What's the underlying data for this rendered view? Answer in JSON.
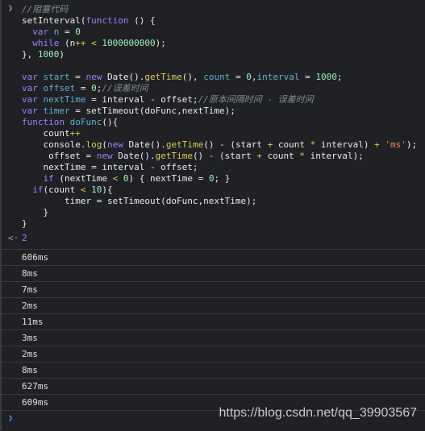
{
  "input": {
    "prompt_icon": "chevron-right-icon",
    "lines": [
      [
        [
          "cm",
          "//阻塞代码"
        ]
      ],
      [
        [
          "pl",
          "setInterval("
        ],
        [
          "kw",
          "function"
        ],
        [
          "pl",
          " () {"
        ]
      ],
      [
        [
          "pl",
          "  "
        ],
        [
          "kw",
          "var"
        ],
        [
          "var",
          " n"
        ],
        [
          "pl",
          " = "
        ],
        [
          "num",
          "0"
        ]
      ],
      [
        [
          "pl",
          "  "
        ],
        [
          "kw",
          "while"
        ],
        [
          "pl",
          " (n"
        ],
        [
          "op",
          "++"
        ],
        [
          "pl",
          " "
        ],
        [
          "op",
          "<"
        ],
        [
          "pl",
          " "
        ],
        [
          "num",
          "1000000000"
        ],
        [
          "pl",
          ");"
        ]
      ],
      [
        [
          "pl",
          "}, "
        ],
        [
          "num",
          "1000"
        ],
        [
          "pl",
          ")"
        ]
      ],
      [
        [
          "pl",
          ""
        ]
      ],
      [
        [
          "kw",
          "var"
        ],
        [
          "var",
          " start"
        ],
        [
          "pl",
          " = "
        ],
        [
          "kw",
          "new"
        ],
        [
          "pl",
          " Date()."
        ],
        [
          "fn",
          "getTime"
        ],
        [
          "pl",
          "(), "
        ],
        [
          "var",
          "count"
        ],
        [
          "pl",
          " = "
        ],
        [
          "num",
          "0"
        ],
        [
          "pl",
          ","
        ],
        [
          "var",
          "interval"
        ],
        [
          "pl",
          " = "
        ],
        [
          "num",
          "1000"
        ],
        [
          "pl",
          ";"
        ]
      ],
      [
        [
          "kw",
          "var"
        ],
        [
          "var",
          " offset"
        ],
        [
          "pl",
          " = "
        ],
        [
          "num",
          "0"
        ],
        [
          "pl",
          ";"
        ],
        [
          "cm",
          "//误差时间"
        ]
      ],
      [
        [
          "kw",
          "var"
        ],
        [
          "var",
          " nextTime"
        ],
        [
          "pl",
          " = interval - offset;"
        ],
        [
          "cm",
          "//原本间隔时间 - 误差时间"
        ]
      ],
      [
        [
          "kw",
          "var"
        ],
        [
          "var",
          " timer"
        ],
        [
          "pl",
          " = setTimeout(doFunc,nextTime);"
        ]
      ],
      [
        [
          "kw",
          "function"
        ],
        [
          "var",
          " doFunc"
        ],
        [
          "pl",
          "(){"
        ]
      ],
      [
        [
          "pl",
          "    count"
        ],
        [
          "op",
          "++"
        ]
      ],
      [
        [
          "pl",
          "    console."
        ],
        [
          "fn",
          "log"
        ],
        [
          "pl",
          "("
        ],
        [
          "kw",
          "new"
        ],
        [
          "pl",
          " Date()."
        ],
        [
          "fn",
          "getTime"
        ],
        [
          "pl",
          "() - (start "
        ],
        [
          "op",
          "+"
        ],
        [
          "pl",
          " count "
        ],
        [
          "op",
          "*"
        ],
        [
          "pl",
          " interval) "
        ],
        [
          "op",
          "+"
        ],
        [
          "pl",
          " "
        ],
        [
          "str",
          "'ms'"
        ],
        [
          "pl",
          ");"
        ]
      ],
      [
        [
          "pl",
          "     offset = "
        ],
        [
          "kw",
          "new"
        ],
        [
          "pl",
          " Date()."
        ],
        [
          "fn",
          "getTime"
        ],
        [
          "pl",
          "() - (start "
        ],
        [
          "op",
          "+"
        ],
        [
          "pl",
          " count "
        ],
        [
          "op",
          "*"
        ],
        [
          "pl",
          " interval);"
        ]
      ],
      [
        [
          "pl",
          "    nextTime = interval - offset;"
        ]
      ],
      [
        [
          "pl",
          "    "
        ],
        [
          "kw",
          "if"
        ],
        [
          "pl",
          " (nextTime "
        ],
        [
          "op",
          "<"
        ],
        [
          "pl",
          " "
        ],
        [
          "num",
          "0"
        ],
        [
          "pl",
          ") { nextTime = "
        ],
        [
          "num",
          "0"
        ],
        [
          "pl",
          "; }"
        ]
      ],
      [
        [
          "pl",
          "  "
        ],
        [
          "kw",
          "if"
        ],
        [
          "pl",
          "(count "
        ],
        [
          "op",
          "<"
        ],
        [
          "pl",
          " "
        ],
        [
          "num",
          "10"
        ],
        [
          "pl",
          "){"
        ]
      ],
      [
        [
          "pl",
          "        timer = setTimeout(doFunc,nextTime);"
        ]
      ],
      [
        [
          "pl",
          "    }"
        ]
      ],
      [
        [
          "pl",
          "}"
        ]
      ]
    ]
  },
  "result": {
    "icon": "return-arrow-icon",
    "value": "2"
  },
  "output": [
    "606ms",
    "8ms",
    "7ms",
    "2ms",
    "11ms",
    "3ms",
    "2ms",
    "8ms",
    "627ms",
    "609ms"
  ],
  "prompt": {
    "icon": "chevron-right-icon"
  },
  "watermark": "https://blog.csdn.net/qq_39903567",
  "colors": {
    "background": "#202124",
    "keyword": "#9980ff",
    "variable": "#5db0d7",
    "number": "#9bf0b9",
    "method": "#dccb5a",
    "string": "#f28b54",
    "comment": "#868c92",
    "prompt": "#4d90fe"
  }
}
